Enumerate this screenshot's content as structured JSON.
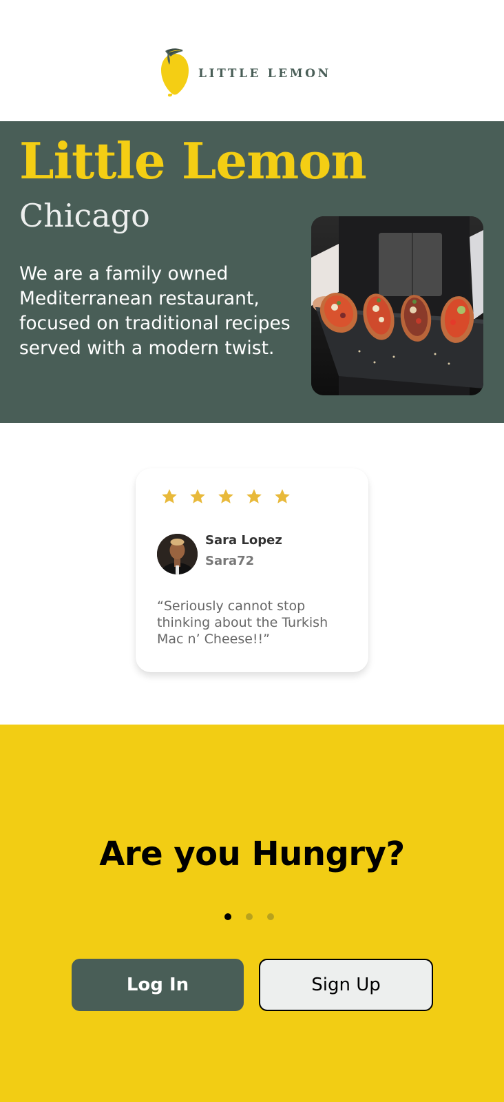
{
  "brand": {
    "logo_text": "LITTLE LEMON",
    "primary_color": "#495e57",
    "accent_color": "#f4ce14"
  },
  "hero": {
    "title": "Little Lemon",
    "city": "Chicago",
    "description": "We are a family owned Mediterranean restaurant, focused on traditional recipes served with a modern twist."
  },
  "testimonial": {
    "rating": 5,
    "rating_max": 5,
    "name": "Sara Lopez",
    "handle": "Sara72",
    "quote": "“Seriously cannot stop thinking about the Turkish Mac n’ Cheese!!”"
  },
  "onboarding": {
    "heading": "Are you Hungry?",
    "page_count": 3,
    "current_page": 1,
    "login_label": "Log In",
    "signup_label": "Sign Up"
  }
}
